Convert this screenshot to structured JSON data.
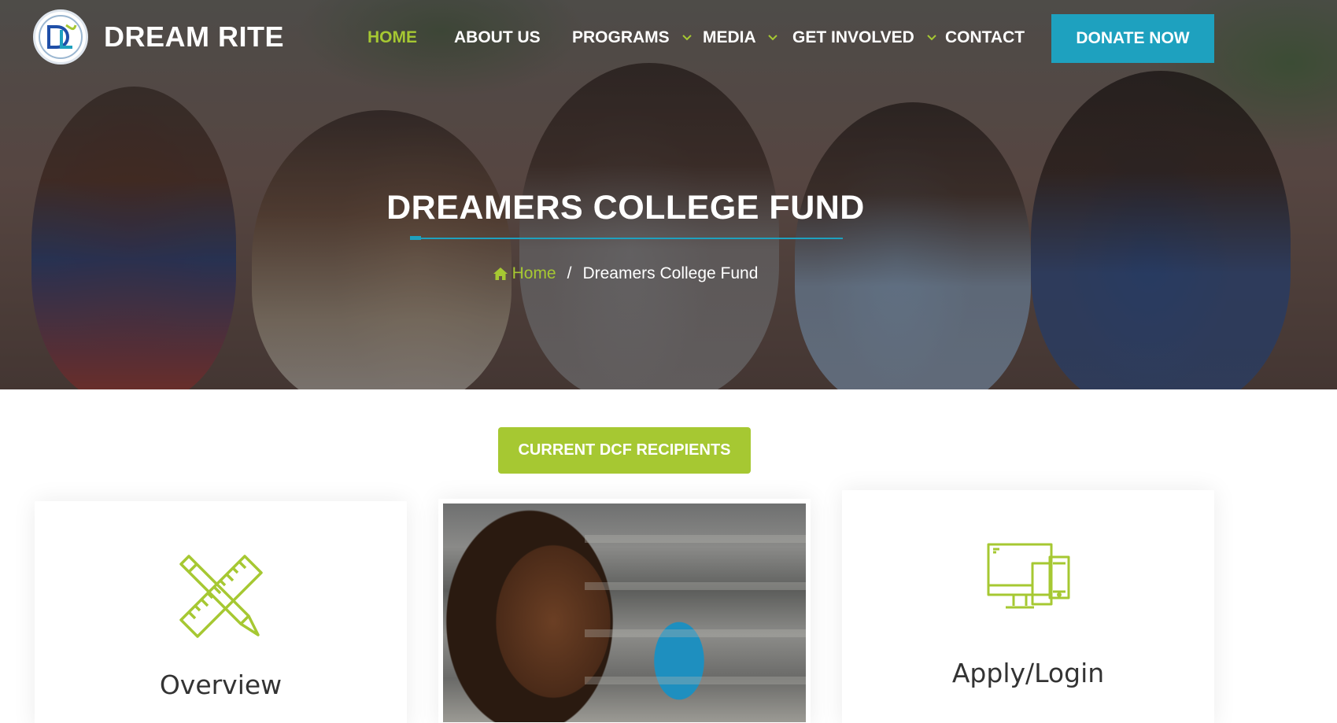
{
  "brand": {
    "name": "DREAM RITE",
    "logo_letters": "DL",
    "logo_ring_text": "Dream Rite"
  },
  "nav": {
    "items": [
      {
        "label": "HOME",
        "active": true,
        "dropdown": false
      },
      {
        "label": "ABOUT US",
        "active": false,
        "dropdown": false
      },
      {
        "label": "PROGRAMS",
        "active": false,
        "dropdown": true
      },
      {
        "label": "MEDIA",
        "active": false,
        "dropdown": true
      },
      {
        "label": "GET INVOLVED",
        "active": false,
        "dropdown": true
      },
      {
        "label": "CONTACT",
        "active": false,
        "dropdown": false
      }
    ],
    "cta": "DONATE NOW"
  },
  "hero": {
    "title": "DREAMERS COLLEGE FUND",
    "breadcrumb": {
      "home": "Home",
      "separator": "/",
      "current": "Dreamers College Fund"
    }
  },
  "content": {
    "recipients_button": "CURRENT DCF RECIPIENTS",
    "cards": [
      {
        "title": "Overview",
        "icon": "pencil-ruler-icon"
      },
      {
        "title": "",
        "icon": "student-photo"
      },
      {
        "title": "Apply/Login",
        "icon": "devices-icon"
      }
    ]
  },
  "colors": {
    "accent_green": "#a6c832",
    "accent_teal": "#1ea1bf",
    "text_dark": "#333333",
    "white": "#ffffff"
  }
}
